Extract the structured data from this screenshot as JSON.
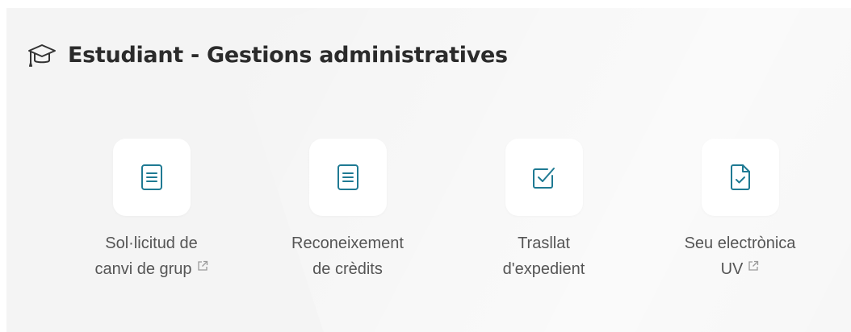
{
  "section": {
    "title": "Estudiant - Gestions administratives",
    "icon": "graduation-cap-icon"
  },
  "colors": {
    "panel_bg": "#f4f4f4",
    "tile_bg": "#ffffff",
    "icon_accent": "#1f7a93",
    "label_text": "#555555",
    "title_text": "#2b2b2b"
  },
  "items": [
    {
      "line1": "Sol·licitud de",
      "line2": "canvi de grup",
      "external": true,
      "icon": "document-icon"
    },
    {
      "line1": "Reconeixement",
      "line2": "de crèdits",
      "external": false,
      "icon": "document-icon"
    },
    {
      "line1": "Trasllat",
      "line2": "d'expedient",
      "external": false,
      "icon": "checkbox-icon"
    },
    {
      "line1": "Seu electrònica",
      "line2": "UV",
      "external": true,
      "icon": "file-check-icon"
    }
  ]
}
